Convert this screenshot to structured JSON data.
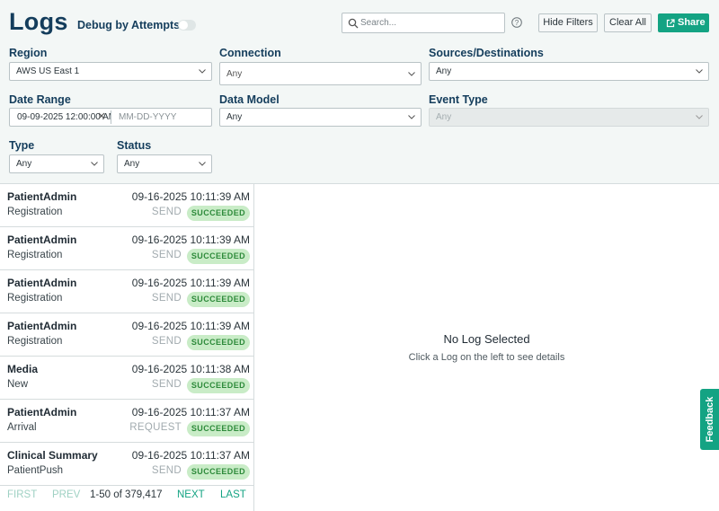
{
  "header": {
    "title": "Logs",
    "debug_label": "Debug by Attempts",
    "search_placeholder": "Search...",
    "hide_filters": "Hide Filters",
    "clear_all": "Clear All",
    "share": "Share"
  },
  "filters": {
    "region": {
      "label": "Region",
      "value": "AWS US East 1"
    },
    "connection": {
      "label": "Connection",
      "value": "Any"
    },
    "sources": {
      "label": "Sources/Destinations",
      "value": "Any"
    },
    "date_range": {
      "label": "Date Range",
      "start": "09-09-2025 12:00:00 AM",
      "end_placeholder": "MM-DD-YYYY"
    },
    "data_model": {
      "label": "Data Model",
      "value": "Any"
    },
    "event_type": {
      "label": "Event Type",
      "value": "Any"
    },
    "type": {
      "label": "Type",
      "value": "Any"
    },
    "status": {
      "label": "Status",
      "value": "Any"
    }
  },
  "logs": [
    {
      "name": "PatientAdmin",
      "time": "09-16-2025 10:11:39 AM",
      "sub": "Registration",
      "kind": "SEND",
      "status": "SUCCEEDED"
    },
    {
      "name": "PatientAdmin",
      "time": "09-16-2025 10:11:39 AM",
      "sub": "Registration",
      "kind": "SEND",
      "status": "SUCCEEDED"
    },
    {
      "name": "PatientAdmin",
      "time": "09-16-2025 10:11:39 AM",
      "sub": "Registration",
      "kind": "SEND",
      "status": "SUCCEEDED"
    },
    {
      "name": "PatientAdmin",
      "time": "09-16-2025 10:11:39 AM",
      "sub": "Registration",
      "kind": "SEND",
      "status": "SUCCEEDED"
    },
    {
      "name": "Media",
      "time": "09-16-2025 10:11:38 AM",
      "sub": "New",
      "kind": "SEND",
      "status": "SUCCEEDED"
    },
    {
      "name": "PatientAdmin",
      "time": "09-16-2025 10:11:37 AM",
      "sub": "Arrival",
      "kind": "REQUEST",
      "status": "SUCCEEDED"
    },
    {
      "name": "Clinical Summary",
      "time": "09-16-2025 10:11:37 AM",
      "sub": "PatientPush",
      "kind": "SEND",
      "status": "SUCCEEDED"
    }
  ],
  "pager": {
    "first": "FIRST",
    "prev": "PREV",
    "count": "1-50 of 379,417",
    "next": "NEXT",
    "last": "LAST"
  },
  "detail": {
    "empty_title": "No Log Selected",
    "empty_sub": "Click a Log on the left to see details"
  },
  "feedback": "Feedback",
  "colors": {
    "accent": "#14a383",
    "title": "#143d5c",
    "success_bg": "#c9ecc7",
    "success_text": "#2d8a3a"
  }
}
